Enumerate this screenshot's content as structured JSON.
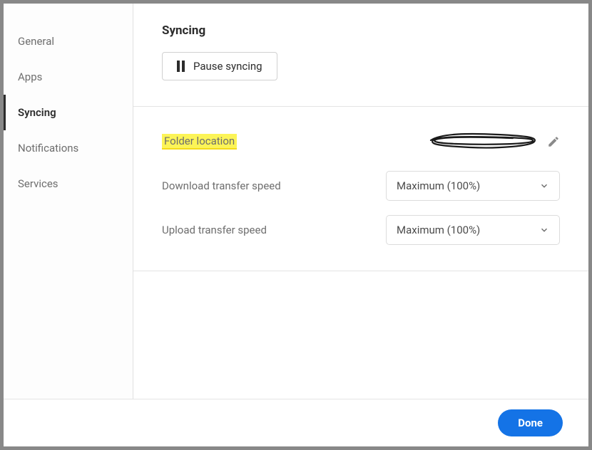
{
  "sidebar": {
    "items": [
      {
        "label": "General"
      },
      {
        "label": "Apps"
      },
      {
        "label": "Syncing"
      },
      {
        "label": "Notifications"
      },
      {
        "label": "Services"
      }
    ]
  },
  "syncing": {
    "title": "Syncing",
    "pause_label": "Pause syncing",
    "folder_location_label": "Folder location",
    "download_label": "Download transfer speed",
    "upload_label": "Upload transfer speed",
    "download_value": "Maximum (100%)",
    "upload_value": "Maximum (100%)"
  },
  "footer": {
    "done_label": "Done"
  }
}
